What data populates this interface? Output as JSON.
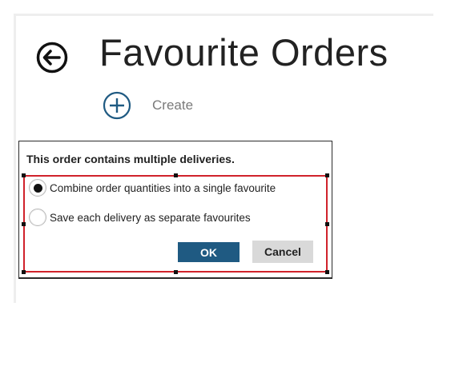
{
  "header": {
    "title": "Favourite Orders",
    "back_icon": "back-arrow-icon",
    "create_label": "Create",
    "create_icon": "plus-circle-icon"
  },
  "dialog": {
    "message": "This order contains multiple deliveries.",
    "options": [
      {
        "label": "Combine order quantities into a single favourite",
        "selected": true
      },
      {
        "label": "Save each delivery as separate favourites",
        "selected": false
      }
    ],
    "ok_label": "OK",
    "cancel_label": "Cancel"
  },
  "colors": {
    "accent": "#1f5a82",
    "selection_outline": "#d0222b",
    "cancel_bg": "#d9d9d9"
  }
}
